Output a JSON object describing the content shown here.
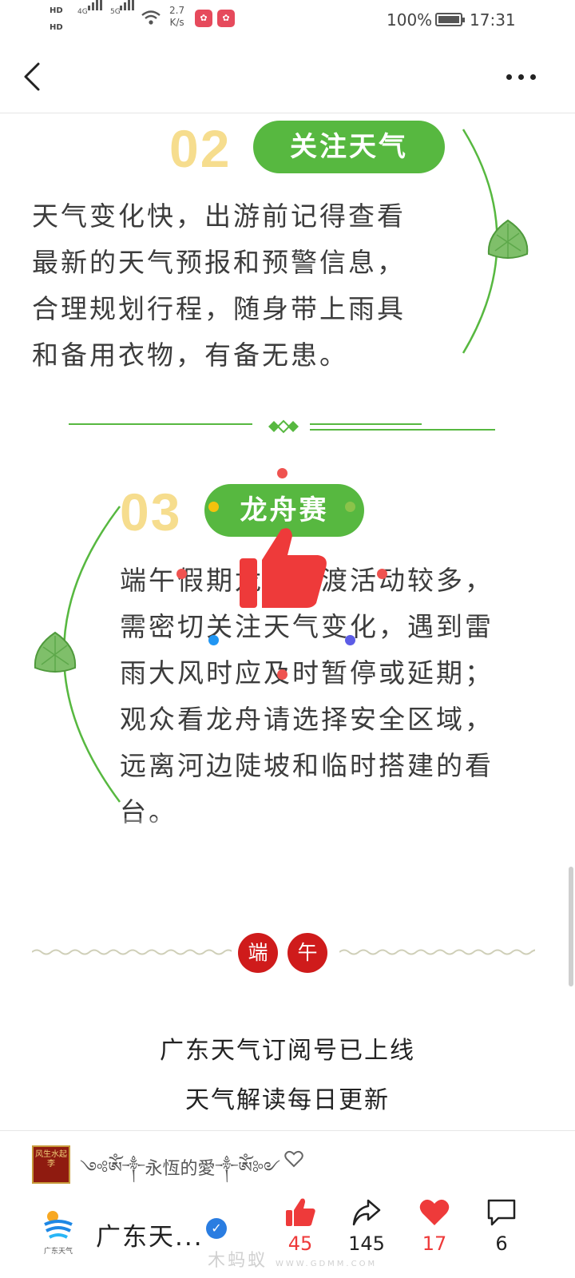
{
  "status_bar": {
    "hd1": "HD",
    "hd2": "HD",
    "net1": "4G",
    "net2": "5G",
    "speed_value": "2.7",
    "speed_unit": "K/s",
    "battery": "100%",
    "time": "17:31"
  },
  "nav": {
    "back_icon": "chevron-left-icon",
    "more_icon": "more-horizontal-icon"
  },
  "article": {
    "section02": {
      "number": "02",
      "title": "关注天气",
      "lines": [
        "天气变化快，出游前记得查看",
        "最新的天气预报和预警信息，",
        "合理规划行程，随身带上雨具",
        "和备用衣物，有备无患。"
      ]
    },
    "section03": {
      "number": "03",
      "title": "龙舟赛",
      "lines": [
        "端午假期龙舟竞渡活动较多，",
        "需密切关注天气变化，遇到雷",
        "雨大风时应及时暂停或延期；",
        "观众看龙舟请选择安全区域，",
        "远离河边陡坡和临时搭建的看",
        "台。"
      ]
    },
    "festival": [
      "端",
      "午"
    ],
    "promo_line1": "广东天气订阅号已上线",
    "promo_line2": "天气解读每日更新",
    "colors": {
      "green": "#57b840",
      "number_yellow": "#f6dd8e",
      "festival_red": "#cf1b1b"
    }
  },
  "comment": {
    "user_text": "༺ༀ༒永恆的愛༒ༀ༻",
    "avatar_text": "风生水起 李",
    "like_icon": "heart-outline-icon"
  },
  "bottom_bar": {
    "account_name": "广东天...",
    "account_logo_text": "广东天气",
    "verified_icon": "check-badge-icon",
    "likes": "45",
    "shares": "145",
    "favorites": "17",
    "comments": "6"
  },
  "watermark": "木蚂蚁",
  "watermark_sub": "WWW.GDMM.COM"
}
